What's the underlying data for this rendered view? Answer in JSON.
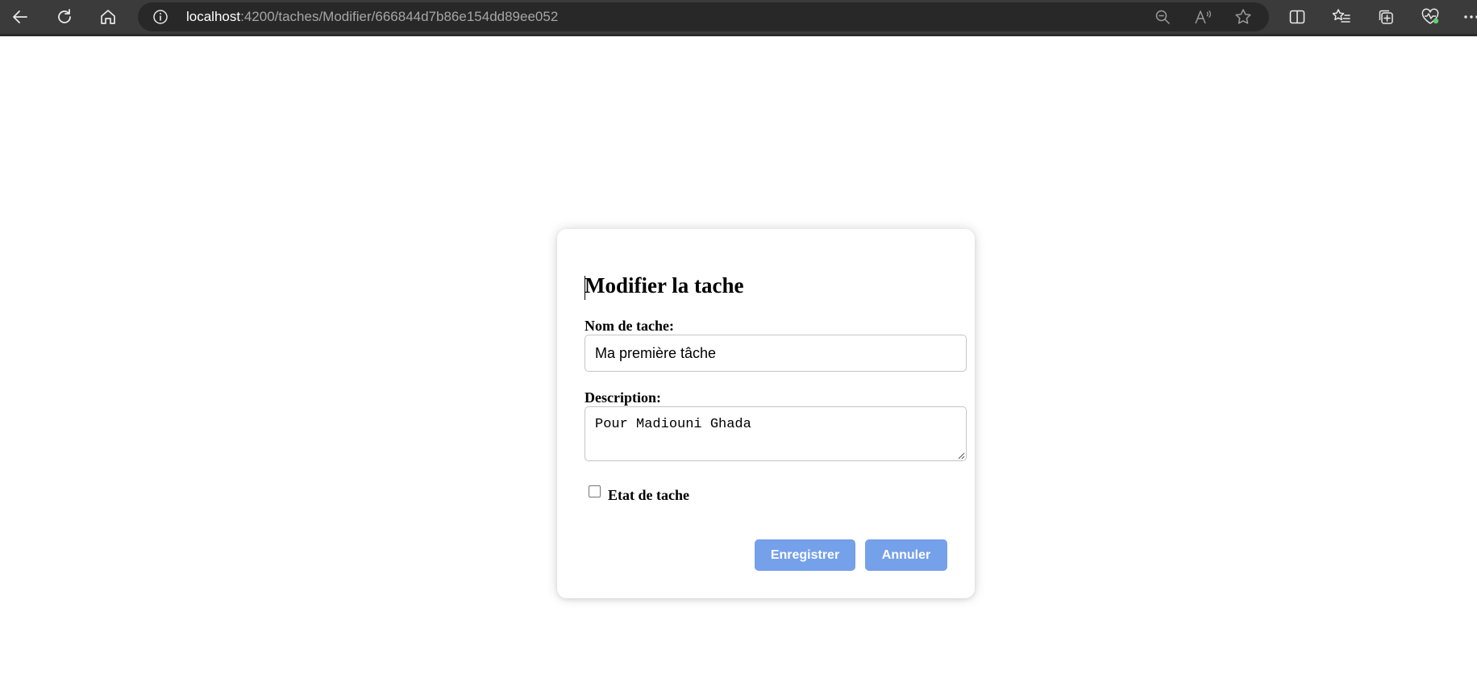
{
  "browser": {
    "url_host": "localhost",
    "url_rest": ":4200/taches/Modifier/666844d7b86e154dd89ee052",
    "icons": {
      "back": "back-arrow-icon",
      "refresh": "refresh-icon",
      "home": "home-icon",
      "site_info": "info-icon",
      "zoom": "zoom-out-icon",
      "read_aloud": "read-aloud-icon",
      "favorite": "star-icon",
      "split_screen": "split-screen-icon",
      "favorites": "favorites-list-icon",
      "collections": "collections-icon",
      "health": "browser-essentials-icon",
      "more": "more-icon"
    },
    "colors": {
      "toolbar": "#3b3b3b",
      "address_bar": "#282828",
      "health_accent": "#5fd26a"
    }
  },
  "form": {
    "title": "Modifier la tache",
    "name_label": "Nom de tache:",
    "name_value": "Ma première tâche",
    "description_label": "Description:",
    "description_value": "Pour Madiouni Ghada",
    "status_label": "Etat de tache",
    "status_checked": false,
    "save_label": "Enregistrer",
    "cancel_label": "Annuler",
    "button_color": "#75a0ea"
  }
}
